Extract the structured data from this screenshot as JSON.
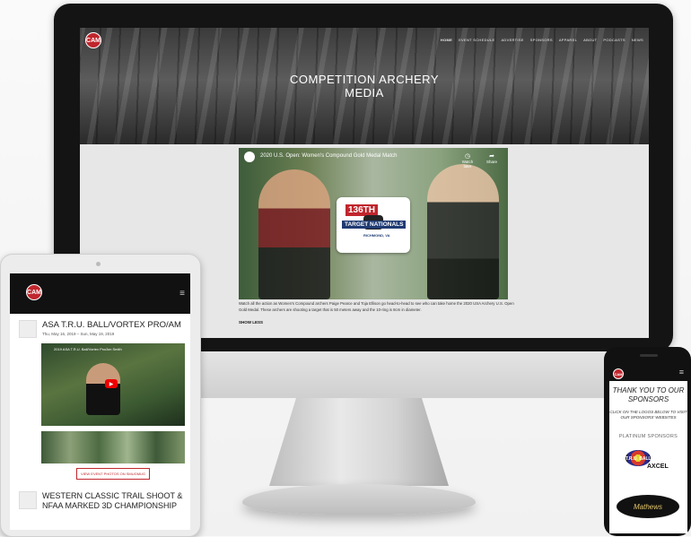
{
  "monitor": {
    "nav": [
      "HOME",
      "EVENT SCHEDULE",
      "ADVERTISE",
      "SPONSORS",
      "APPAREL",
      "ABOUT",
      "PODCASTS",
      "NEWS"
    ],
    "hero_title_line1": "COMPETITION ARCHERY",
    "hero_title_line2": "MEDIA",
    "logo_text": "CAM",
    "video": {
      "title": "2020 U.S. Open: Women's Compound Gold Medal Match",
      "watch_later": "Watch later",
      "share": "Share",
      "badge_number": "136TH",
      "badge_title": "TARGET NATIONALS",
      "badge_location": "RICHMOND, VA"
    },
    "description": "Watch all the action as Women's Compound archers Paige Pearce and Toja Ellison go head-to-head to see who can take home the 2020 USA Archery U.S. Open Gold Medal. These archers are shooting a target that is 50 meters away and the 10-ring is 8cm in diameter.",
    "show_less": "SHOW LESS"
  },
  "tablet": {
    "event1_title": "ASA T.R.U. BALL/VORTEX PRO/AM",
    "event1_date": "Thu, May 16, 2019 – Sun, May 19, 2019",
    "video_title": "2019 ASA T.R.U. Ball/Vortex Pro/Am Smith",
    "photos_button": "VIEW EVENT PHOTOS ON SMUGMUG",
    "event2_title": "WESTERN CLASSIC TRAIL SHOOT & NFAA MARKED 3D CHAMPIONSHIP"
  },
  "phone": {
    "thanks": "THANK YOU TO OUR SPONSORS",
    "click_note": "CLICK ON THE LOGOS BELOW TO VISIT OUR SPONSORS' WEBSITES",
    "platinum": "PLATINUM SPONSORS",
    "sponsor1": "T.R.U. BALL",
    "sponsor2": "AXCEL",
    "sponsor3": "Mathews"
  }
}
